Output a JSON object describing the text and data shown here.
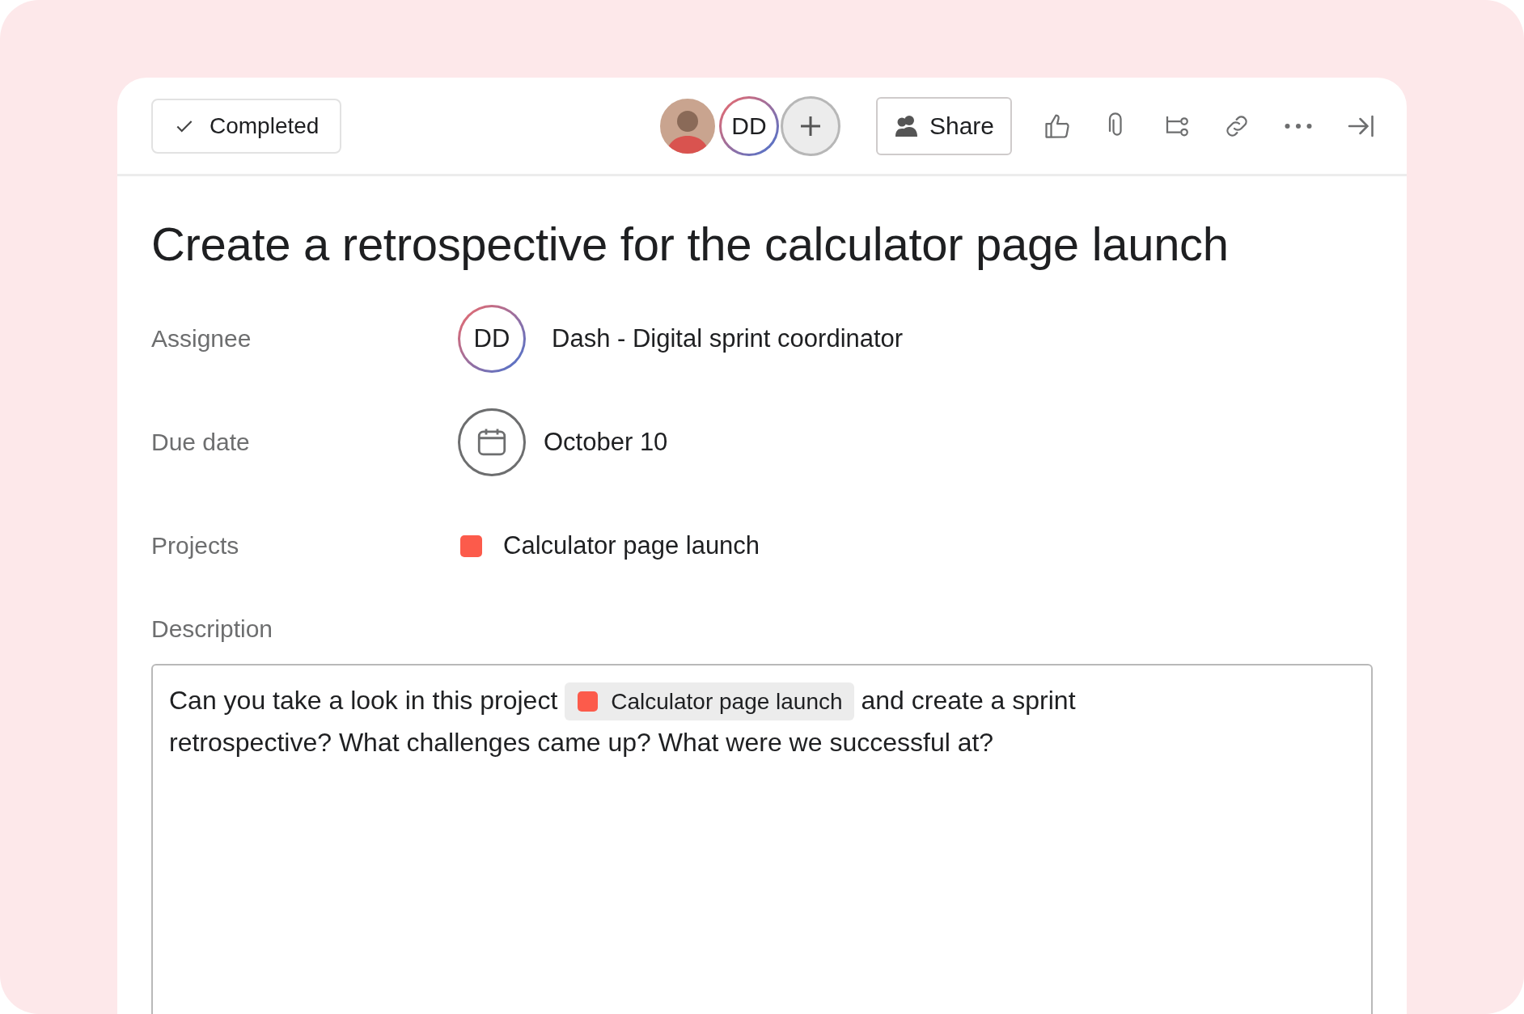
{
  "toolbar": {
    "complete_button": {
      "label": "Completed",
      "checked": false
    },
    "collaborators": [
      {
        "kind": "photo"
      },
      {
        "kind": "initials",
        "initials": "DD"
      }
    ],
    "share_button": {
      "label": "Share"
    }
  },
  "task": {
    "title": "Create a retrospective for the calculator page launch",
    "fields": [
      {
        "kind": "assignee",
        "label": "Assignee",
        "initials": "DD",
        "value": "Dash - Digital sprint coordinator"
      },
      {
        "kind": "date",
        "label": "Due date",
        "value": "October 10"
      },
      {
        "kind": "project",
        "label": "Projects",
        "value": "Calculator page launch",
        "color": "#fc5b4b"
      }
    ],
    "description": {
      "label": "Description",
      "text_before": "Can you take a look in this project",
      "chip": {
        "label": "Calculator page launch",
        "color": "#fc5b4b"
      },
      "text_after": "and create a sprint retrospective? What challenges came up? What were we successful at?"
    }
  }
}
